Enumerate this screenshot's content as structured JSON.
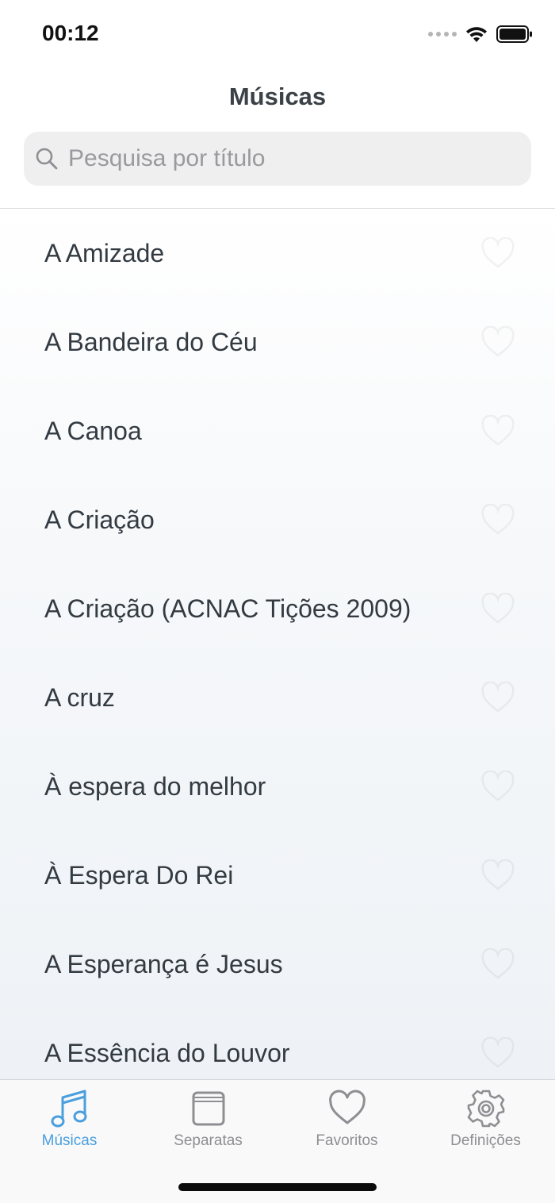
{
  "status_bar": {
    "time": "00:12"
  },
  "header": {
    "title": "Músicas",
    "search_placeholder": "Pesquisa por título"
  },
  "songs": [
    "A Amizade",
    "A Bandeira do Céu",
    "A Canoa",
    "A Criação",
    "A Criação (ACNAC Tições 2009)",
    "A cruz",
    "À espera do melhor",
    "À Espera Do Rei",
    "A Esperança é Jesus",
    "A Essência do Louvor"
  ],
  "tabs": [
    {
      "label": "Músicas",
      "icon": "music-note-icon",
      "active": true
    },
    {
      "label": "Separatas",
      "icon": "booklet-icon",
      "active": false
    },
    {
      "label": "Favoritos",
      "icon": "heart-icon",
      "active": false
    },
    {
      "label": "Definições",
      "icon": "gear-icon",
      "active": false
    }
  ],
  "colors": {
    "accent": "#4a9fde",
    "inactive_tab": "#8e8e93",
    "text": "#333b42"
  }
}
